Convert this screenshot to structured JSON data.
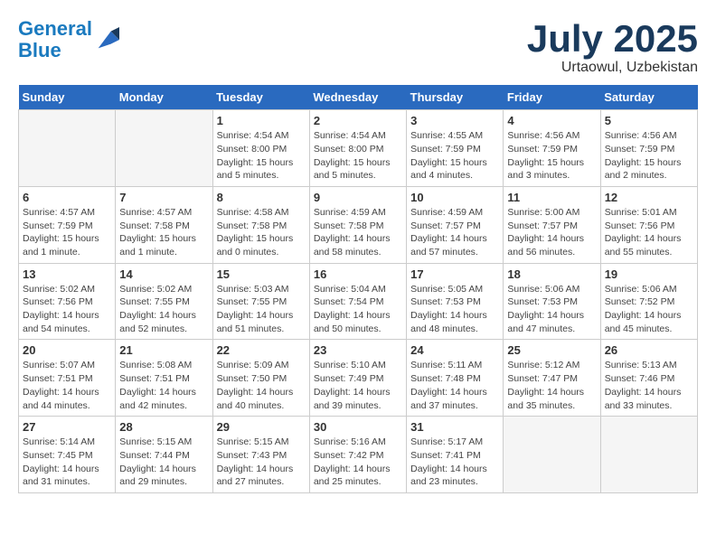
{
  "header": {
    "logo_line1": "General",
    "logo_line2": "Blue",
    "month_year": "July 2025",
    "location": "Urtaowul, Uzbekistan"
  },
  "weekdays": [
    "Sunday",
    "Monday",
    "Tuesday",
    "Wednesday",
    "Thursday",
    "Friday",
    "Saturday"
  ],
  "weeks": [
    [
      {
        "day": "",
        "detail": ""
      },
      {
        "day": "",
        "detail": ""
      },
      {
        "day": "1",
        "detail": "Sunrise: 4:54 AM\nSunset: 8:00 PM\nDaylight: 15 hours\nand 5 minutes."
      },
      {
        "day": "2",
        "detail": "Sunrise: 4:54 AM\nSunset: 8:00 PM\nDaylight: 15 hours\nand 5 minutes."
      },
      {
        "day": "3",
        "detail": "Sunrise: 4:55 AM\nSunset: 7:59 PM\nDaylight: 15 hours\nand 4 minutes."
      },
      {
        "day": "4",
        "detail": "Sunrise: 4:56 AM\nSunset: 7:59 PM\nDaylight: 15 hours\nand 3 minutes."
      },
      {
        "day": "5",
        "detail": "Sunrise: 4:56 AM\nSunset: 7:59 PM\nDaylight: 15 hours\nand 2 minutes."
      }
    ],
    [
      {
        "day": "6",
        "detail": "Sunrise: 4:57 AM\nSunset: 7:59 PM\nDaylight: 15 hours\nand 1 minute."
      },
      {
        "day": "7",
        "detail": "Sunrise: 4:57 AM\nSunset: 7:58 PM\nDaylight: 15 hours\nand 1 minute."
      },
      {
        "day": "8",
        "detail": "Sunrise: 4:58 AM\nSunset: 7:58 PM\nDaylight: 15 hours\nand 0 minutes."
      },
      {
        "day": "9",
        "detail": "Sunrise: 4:59 AM\nSunset: 7:58 PM\nDaylight: 14 hours\nand 58 minutes."
      },
      {
        "day": "10",
        "detail": "Sunrise: 4:59 AM\nSunset: 7:57 PM\nDaylight: 14 hours\nand 57 minutes."
      },
      {
        "day": "11",
        "detail": "Sunrise: 5:00 AM\nSunset: 7:57 PM\nDaylight: 14 hours\nand 56 minutes."
      },
      {
        "day": "12",
        "detail": "Sunrise: 5:01 AM\nSunset: 7:56 PM\nDaylight: 14 hours\nand 55 minutes."
      }
    ],
    [
      {
        "day": "13",
        "detail": "Sunrise: 5:02 AM\nSunset: 7:56 PM\nDaylight: 14 hours\nand 54 minutes."
      },
      {
        "day": "14",
        "detail": "Sunrise: 5:02 AM\nSunset: 7:55 PM\nDaylight: 14 hours\nand 52 minutes."
      },
      {
        "day": "15",
        "detail": "Sunrise: 5:03 AM\nSunset: 7:55 PM\nDaylight: 14 hours\nand 51 minutes."
      },
      {
        "day": "16",
        "detail": "Sunrise: 5:04 AM\nSunset: 7:54 PM\nDaylight: 14 hours\nand 50 minutes."
      },
      {
        "day": "17",
        "detail": "Sunrise: 5:05 AM\nSunset: 7:53 PM\nDaylight: 14 hours\nand 48 minutes."
      },
      {
        "day": "18",
        "detail": "Sunrise: 5:06 AM\nSunset: 7:53 PM\nDaylight: 14 hours\nand 47 minutes."
      },
      {
        "day": "19",
        "detail": "Sunrise: 5:06 AM\nSunset: 7:52 PM\nDaylight: 14 hours\nand 45 minutes."
      }
    ],
    [
      {
        "day": "20",
        "detail": "Sunrise: 5:07 AM\nSunset: 7:51 PM\nDaylight: 14 hours\nand 44 minutes."
      },
      {
        "day": "21",
        "detail": "Sunrise: 5:08 AM\nSunset: 7:51 PM\nDaylight: 14 hours\nand 42 minutes."
      },
      {
        "day": "22",
        "detail": "Sunrise: 5:09 AM\nSunset: 7:50 PM\nDaylight: 14 hours\nand 40 minutes."
      },
      {
        "day": "23",
        "detail": "Sunrise: 5:10 AM\nSunset: 7:49 PM\nDaylight: 14 hours\nand 39 minutes."
      },
      {
        "day": "24",
        "detail": "Sunrise: 5:11 AM\nSunset: 7:48 PM\nDaylight: 14 hours\nand 37 minutes."
      },
      {
        "day": "25",
        "detail": "Sunrise: 5:12 AM\nSunset: 7:47 PM\nDaylight: 14 hours\nand 35 minutes."
      },
      {
        "day": "26",
        "detail": "Sunrise: 5:13 AM\nSunset: 7:46 PM\nDaylight: 14 hours\nand 33 minutes."
      }
    ],
    [
      {
        "day": "27",
        "detail": "Sunrise: 5:14 AM\nSunset: 7:45 PM\nDaylight: 14 hours\nand 31 minutes."
      },
      {
        "day": "28",
        "detail": "Sunrise: 5:15 AM\nSunset: 7:44 PM\nDaylight: 14 hours\nand 29 minutes."
      },
      {
        "day": "29",
        "detail": "Sunrise: 5:15 AM\nSunset: 7:43 PM\nDaylight: 14 hours\nand 27 minutes."
      },
      {
        "day": "30",
        "detail": "Sunrise: 5:16 AM\nSunset: 7:42 PM\nDaylight: 14 hours\nand 25 minutes."
      },
      {
        "day": "31",
        "detail": "Sunrise: 5:17 AM\nSunset: 7:41 PM\nDaylight: 14 hours\nand 23 minutes."
      },
      {
        "day": "",
        "detail": ""
      },
      {
        "day": "",
        "detail": ""
      }
    ]
  ]
}
